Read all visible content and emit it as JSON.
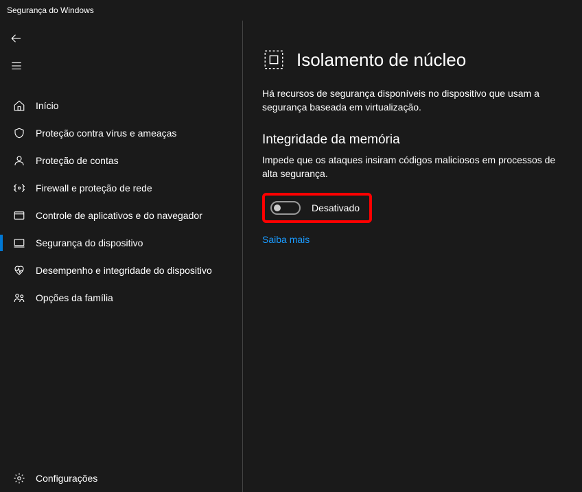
{
  "window": {
    "title": "Segurança do Windows"
  },
  "sidebar": {
    "items": [
      {
        "label": "Início"
      },
      {
        "label": "Proteção contra vírus e ameaças"
      },
      {
        "label": "Proteção de contas"
      },
      {
        "label": "Firewall e proteção de rede"
      },
      {
        "label": "Controle de aplicativos e do navegador"
      },
      {
        "label": "Segurança do dispositivo"
      },
      {
        "label": "Desempenho e integridade do dispositivo"
      },
      {
        "label": "Opções da família"
      }
    ],
    "settings_label": "Configurações"
  },
  "main": {
    "title": "Isolamento de núcleo",
    "description": "Há recursos de segurança disponíveis no dispositivo que usam a segurança baseada em virtualização.",
    "section": {
      "title": "Integridade da memória",
      "description": "Impede que os ataques insiram códigos maliciosos em processos de alta segurança.",
      "toggle_label": "Desativado",
      "learn_more": "Saiba mais"
    }
  }
}
